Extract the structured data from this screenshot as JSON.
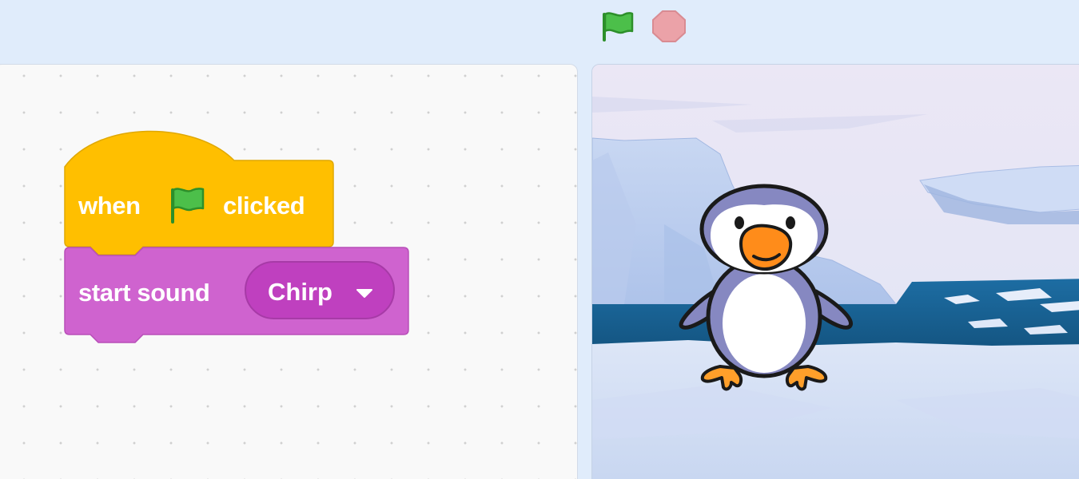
{
  "controls": {
    "green_flag_icon": "green-flag-icon",
    "stop_icon": "stop-sign-icon",
    "flag_color": "#3dba39",
    "stop_color": "#e8a0a6"
  },
  "script": {
    "hat_block": {
      "prefix": "when",
      "icon": "green-flag-icon",
      "suffix": "clicked",
      "color": "#ffbf00"
    },
    "sound_block": {
      "label": "start sound",
      "selected_sound": "Chirp",
      "dropdown_icon": "dropdown-triangle-icon",
      "color": "#cf63cf"
    }
  },
  "stage": {
    "backdrop": "arctic-backdrop",
    "sprite": "penguin-sprite"
  }
}
